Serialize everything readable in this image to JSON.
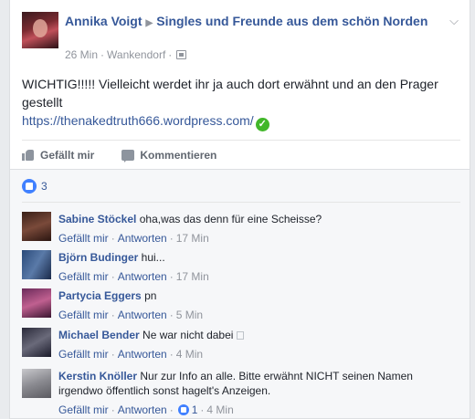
{
  "post": {
    "author": "Annika Voigt",
    "group": "Singles und Freunde aus dem schön Norden",
    "time": "26 Min",
    "location": "Wankendorf",
    "text": "WICHTIG!!!!! Vielleicht werdet ihr ja auch dort erwähnt und an den Prager gestellt",
    "link": "https://thenakedtruth666.wordpress.com/",
    "avatar_color": "#7a2a30"
  },
  "actions": {
    "like_label": "Gefällt mir",
    "comment_label": "Kommentieren"
  },
  "likes": {
    "count": "3",
    "icon": "like-icon"
  },
  "comments": [
    {
      "author": "Sabine Stöckel",
      "text": "oha,was das denn für eine Scheisse?",
      "like": "Gefällt mir",
      "reply": "Antworten",
      "time": "17 Min",
      "avatar_color": "#5a3a30"
    },
    {
      "author": "Björn Budinger",
      "text": "hui...",
      "like": "Gefällt mir",
      "reply": "Antworten",
      "time": "17 Min",
      "avatar_color": "#3a5a8a"
    },
    {
      "author": "Partycia Eggers",
      "text": "pn",
      "like": "Gefällt mir",
      "reply": "Antworten",
      "time": "5 Min",
      "avatar_color": "#8a3a6a"
    },
    {
      "author": "Michael Bender",
      "text": "Ne war nicht dabei",
      "like": "Gefällt mir",
      "reply": "Antworten",
      "time": "4 Min",
      "avatar_color": "#4a4a5a"
    },
    {
      "author": "Kerstin Knöller",
      "text": "Nur zur Info an alle. Bitte erwähnt NICHT seinen Namen irgendwo öffentlich sonst hagelt's Anzeigen.",
      "like": "Gefällt mir",
      "reply": "Antworten",
      "likes": "1",
      "time": "4 Min",
      "avatar_color": "#9a9aa0"
    }
  ]
}
